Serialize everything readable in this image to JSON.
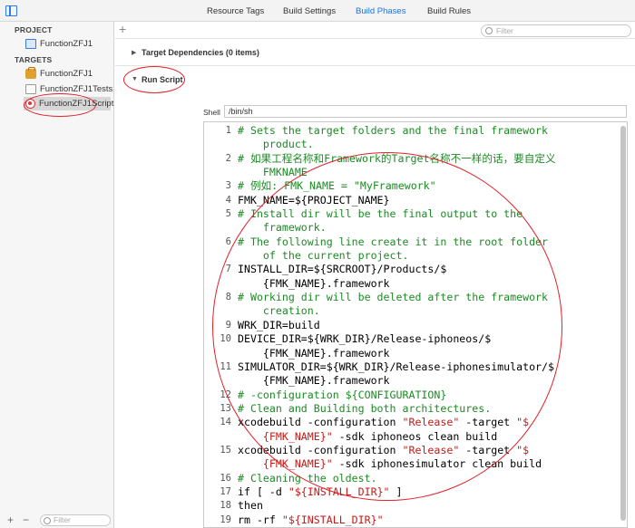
{
  "tabs": [
    {
      "label": "Resource Tags",
      "active": false
    },
    {
      "label": "Build Settings",
      "active": false
    },
    {
      "label": "Build Phases",
      "active": true
    },
    {
      "label": "Build Rules",
      "active": false
    }
  ],
  "navigator": {
    "project_header": "PROJECT",
    "project_item": "FunctionZFJ1",
    "targets_header": "TARGETS",
    "targets": [
      {
        "label": "FunctionZFJ1",
        "icon": "app-target-icon"
      },
      {
        "label": "FunctionZFJ1Tests",
        "icon": "test-bundle-icon"
      },
      {
        "label": "FunctionZFJ1Script",
        "icon": "aggregate-target-icon",
        "selected": true
      }
    ],
    "add_label": "+",
    "remove_label": "−",
    "filter_placeholder": "Filter"
  },
  "editor": {
    "add_label": "+",
    "filter_placeholder": "Filter",
    "phases": [
      {
        "title": "Target Dependencies (0 items)",
        "expanded": false
      },
      {
        "title": "Run Script",
        "expanded": true
      }
    ],
    "shell_label": "Shell",
    "shell_value": "/bin/sh"
  },
  "script": {
    "lines": [
      {
        "n": "1",
        "kind": "comment",
        "parts": [
          {
            "t": "# Sets the target folders and the final framework"
          }
        ]
      },
      {
        "n": "",
        "kind": "comment",
        "parts": [
          {
            "t": "    product."
          }
        ]
      },
      {
        "n": "2",
        "kind": "comment",
        "parts": [
          {
            "t": "# 如果工程名称和Framework的Target名称不一样的话，要自定义"
          }
        ]
      },
      {
        "n": "",
        "kind": "comment",
        "parts": [
          {
            "t": "    FMKNAME"
          }
        ]
      },
      {
        "n": "3",
        "kind": "comment",
        "parts": [
          {
            "t": "# 例如: FMK_NAME = \"MyFramework\""
          }
        ]
      },
      {
        "n": "4",
        "kind": "code",
        "parts": [
          {
            "t": "FMK_NAME=${PROJECT_NAME}"
          }
        ]
      },
      {
        "n": "5",
        "kind": "comment",
        "parts": [
          {
            "t": "# Install dir will be the final output to the"
          }
        ]
      },
      {
        "n": "",
        "kind": "comment",
        "parts": [
          {
            "t": "    framework."
          }
        ]
      },
      {
        "n": "6",
        "kind": "comment",
        "parts": [
          {
            "t": "# The following line create it in the root folder"
          }
        ]
      },
      {
        "n": "",
        "kind": "comment",
        "parts": [
          {
            "t": "    of the current project."
          }
        ]
      },
      {
        "n": "7",
        "kind": "code",
        "parts": [
          {
            "t": "INSTALL_DIR=${SRCROOT}/Products/$"
          }
        ]
      },
      {
        "n": "",
        "kind": "code",
        "parts": [
          {
            "t": "    {FMK_NAME}.framework"
          }
        ]
      },
      {
        "n": "8",
        "kind": "comment",
        "parts": [
          {
            "t": "# Working dir will be deleted after the framework"
          }
        ]
      },
      {
        "n": "",
        "kind": "comment",
        "parts": [
          {
            "t": "    creation."
          }
        ]
      },
      {
        "n": "9",
        "kind": "code",
        "parts": [
          {
            "t": "WRK_DIR=build"
          }
        ]
      },
      {
        "n": "10",
        "kind": "code",
        "parts": [
          {
            "t": "DEVICE_DIR=${WRK_DIR}/Release-iphoneos/$"
          }
        ]
      },
      {
        "n": "",
        "kind": "code",
        "parts": [
          {
            "t": "    {FMK_NAME}.framework"
          }
        ]
      },
      {
        "n": "11",
        "kind": "code",
        "parts": [
          {
            "t": "SIMULATOR_DIR=${WRK_DIR}/Release-iphonesimulator/$"
          }
        ]
      },
      {
        "n": "",
        "kind": "code",
        "parts": [
          {
            "t": "    {FMK_NAME}.framework"
          }
        ]
      },
      {
        "n": "12",
        "kind": "comment",
        "parts": [
          {
            "t": "# -configuration ${CONFIGURATION}"
          }
        ]
      },
      {
        "n": "13",
        "kind": "comment",
        "parts": [
          {
            "t": "# Clean and Building both architectures."
          }
        ]
      },
      {
        "n": "14",
        "kind": "code",
        "parts": [
          {
            "t": "xcodebuild -configuration "
          },
          {
            "t": "\"Release\"",
            "s": true
          },
          {
            "t": " -target "
          },
          {
            "t": "\"$",
            "s": true
          }
        ]
      },
      {
        "n": "",
        "kind": "code",
        "parts": [
          {
            "t": "    "
          },
          {
            "t": "{FMK_NAME}\"",
            "s": true
          },
          {
            "t": " -sdk iphoneos clean build"
          }
        ]
      },
      {
        "n": "15",
        "kind": "code",
        "parts": [
          {
            "t": "xcodebuild -configuration "
          },
          {
            "t": "\"Release\"",
            "s": true
          },
          {
            "t": " -target "
          },
          {
            "t": "\"$",
            "s": true
          }
        ]
      },
      {
        "n": "",
        "kind": "code",
        "parts": [
          {
            "t": "    "
          },
          {
            "t": "{FMK_NAME}\"",
            "s": true
          },
          {
            "t": " -sdk iphonesimulator clean build"
          }
        ]
      },
      {
        "n": "16",
        "kind": "comment",
        "parts": [
          {
            "t": "# Cleaning the oldest."
          }
        ]
      },
      {
        "n": "17",
        "kind": "code",
        "parts": [
          {
            "t": "if [ -d "
          },
          {
            "t": "\"${INSTALL_DIR}\"",
            "s": true
          },
          {
            "t": " ]"
          }
        ]
      },
      {
        "n": "18",
        "kind": "code",
        "parts": [
          {
            "t": "then"
          }
        ]
      },
      {
        "n": "19",
        "kind": "code",
        "parts": [
          {
            "t": "rm -rf "
          },
          {
            "t": "\"${INSTALL_DIR}\"",
            "s": true
          }
        ]
      }
    ]
  },
  "colors": {
    "accent": "#1a73e8",
    "annotation": "#e0202a",
    "comment": "#1d8a24",
    "string": "#c41a16"
  }
}
